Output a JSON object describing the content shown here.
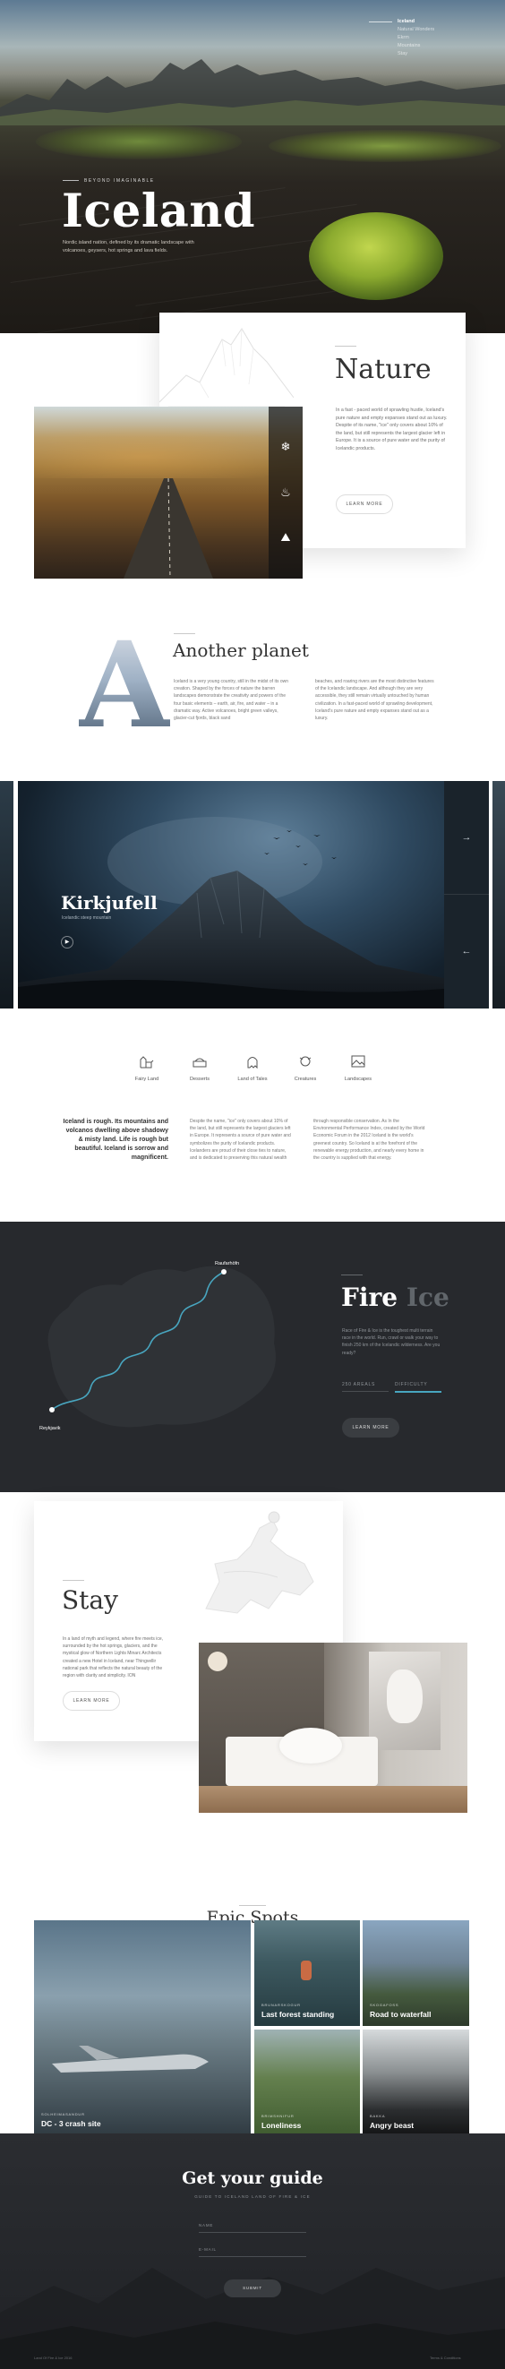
{
  "nav": {
    "items": [
      "Iceland",
      "Natural Wonders",
      "Ekrm",
      "Mountains",
      "Stay"
    ]
  },
  "hero": {
    "tag": "BEYOND IMAGINABLE",
    "title": "Iceland",
    "description": "Nordic island nation, defined by its dramatic landscape with volcanoes, geysers, hot springs and lava fields."
  },
  "nature": {
    "title": "Nature",
    "text": "In a fast - paced world of sprawling hustle, Iceland's pure nature and empty expanses stand out as luxury. Despite of its name, \"ice\" only covers about 10% of the land, but still represents the largest glacier left in Europe. It is a source of pure water and the purity of Icelandic products.",
    "button": "LEARN MORE",
    "icons": [
      "snowflake-icon",
      "fire-icon",
      "mountain-icon"
    ]
  },
  "planet": {
    "letter": "A",
    "title": "Another planet",
    "col1": "Iceland is a very young country, still in the midst of its own creation. Shaped by the forces of nature the barren landscapes demonstrate the creativity and powers of the four basic elements – earth, air, fire, and water – in a dramatic way. Active volcanoes, bright green valleys, glacier-cut fjords, black sand",
    "col2": "beaches, and roaring rivers are the most distinctive features of the Icelandic landscape. And although they are very accessible, they still remain virtually untouched by human civilization. In a fast-paced world of sprawling development, Iceland's pure nature and empty expanses stand out as a luxury."
  },
  "slider": {
    "title": "Kirkjufell",
    "subtitle": "Icelandic steep mountain",
    "next": "→",
    "prev": "←",
    "play": "▶"
  },
  "categories": [
    {
      "label": "Fairy Land",
      "icon": "castle-icon"
    },
    {
      "label": "Desserts",
      "icon": "dessert-icon"
    },
    {
      "label": "Land of Tales",
      "icon": "ghost-icon"
    },
    {
      "label": "Creatures",
      "icon": "creature-icon"
    },
    {
      "label": "Landscapes",
      "icon": "landscape-icon"
    }
  ],
  "quote": {
    "text": "Iceland is rough. Its mountains and volcanos dwelling above shadowy & misty land. Life is rough but beautiful. Iceland is sorrow and magnificent.",
    "col1": "Despite the name, \"ice\" only covers about 10% of the land, but still represents the largest glaciers left in Europe. It represents a source of pure water and symbolizes the purity of Icelandic products. Icelanders are proud of their close ties to nature, and is dedicated to preserving this natural wealth",
    "col2": "through responsible conservation. As In the Environmental Performance Index, created by the World Economic Forum in the 2012 Iceland is the world's greenest country. So Iceland is at the forefront of the renewable energy production, and nearly every home in the country is supplied with that energy."
  },
  "fire": {
    "title_fire": "Fire",
    "title_ice": "Ice",
    "text": "Race of Fire & Ice is the toughest multi terrain race in the world. Run, crawl or walk your way to finish 250 km of the Icelandic wilderness. Are you ready?",
    "tab1": "250 AREALS",
    "tab2": "DIFFICULTY",
    "button": "LEARN MORE",
    "city_start": "Reykjavik",
    "city_end": "Raufarhöfn"
  },
  "stay": {
    "title": "Stay",
    "text": "In a land of myth and legend, where fire meets ice, surrounded by the hot springs, glaciers, and the mystical glow of Northern Lights Minarc Architects created a new Hotel in Iceland, near Thingvellir national park that reflects the natural beauty of the region with clarity and simplicity. ION",
    "button": "LEARN MORE"
  },
  "epic": {
    "title": "Epic Spots",
    "spots": [
      {
        "label": "SOLHEIMASANDUR",
        "title": "DC - 3 crash site"
      },
      {
        "label": "BRUNARSKOGUR",
        "title": "Last forest standing"
      },
      {
        "label": "SKOGAFOSS",
        "title": "Road to waterfall"
      },
      {
        "label": "BRIMSHNIFUR",
        "title": "Loneliness"
      },
      {
        "label": "BAKKA",
        "title": "Angry beast"
      }
    ]
  },
  "guide": {
    "title": "Get your guide",
    "subtitle": "GUIDE TO ICELAND LAND OF FIRE & ICE",
    "name_placeholder": "NAME",
    "email_placeholder": "E-MAIL",
    "button": "SUBMIT"
  },
  "footer": {
    "left": "Land Of Fire & Ice 2016",
    "right": "Terms & Conditions"
  },
  "colors": {
    "accent": "#48a6c0",
    "dark": "#27292d"
  }
}
